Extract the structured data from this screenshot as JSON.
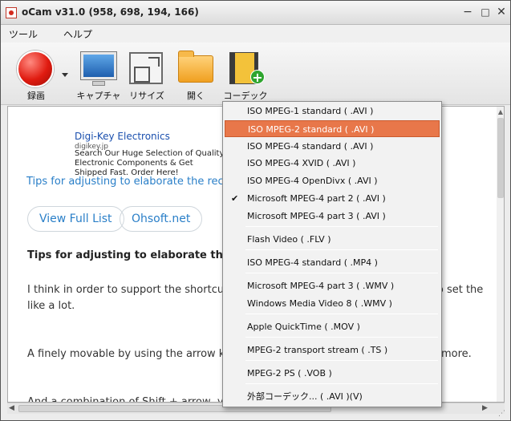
{
  "window": {
    "title": "oCam v31.0 (958, 698, 194, 166)",
    "min_glyph": "−",
    "max_glyph": "□",
    "close_glyph": "✕"
  },
  "menu": {
    "tools": "ツール",
    "help": "ヘルプ"
  },
  "toolbar": {
    "record": "録画",
    "capture": "キャプチャ",
    "resize": "リサイズ",
    "open": "開く",
    "codec": "コーデック"
  },
  "content": {
    "ad_title": "Digi-Key Electronics",
    "ad_url": "digikey.jp",
    "ad_desc": "Search Our Huge Selection of Quality Electronic Components & Get Shipped Fast. Order Here!",
    "article_link": "Tips for adjusting to elaborate the recor",
    "view_full_list": "View Full List",
    "ohsoft": "Ohsoft.net",
    "heading": "Tips for adjusting to elaborate the re",
    "para1": "I think in order to support the shortcut k",
    "para1_right": "w to set the",
    "para1b": "like a lot.",
    "para2": "A finely movable by using the arrow key",
    "para2_right": "more.",
    "para3": "And a combination of Shift + arrow, you"
  },
  "scroll": {
    "up": "▲",
    "left": "◀",
    "right": "▶",
    "grip": "⋰"
  },
  "codec_menu": {
    "check_glyph": "✔",
    "items": [
      "ISO MPEG-1 standard ( .AVI )",
      "ISO MPEG-2 standard ( .AVI )",
      "ISO MPEG-4 standard ( .AVI )",
      "ISO MPEG-4 XVID ( .AVI )",
      "ISO MPEG-4 OpenDivx ( .AVI )",
      "Microsoft MPEG-4 part 2 ( .AVI )",
      "Microsoft MPEG-4 part 3 ( .AVI )",
      "Flash Video ( .FLV )",
      "ISO MPEG-4 standard ( .MP4 )",
      "Microsoft MPEG-4 part 3 ( .WMV )",
      "Windows Media Video 8 ( .WMV )",
      "Apple QuickTime ( .MOV )",
      "MPEG-2 transport stream ( .TS )",
      "MPEG-2 PS ( .VOB )",
      "外部コーデック... ( .AVI )(V)"
    ],
    "selected_index": 1,
    "checked_index": 5
  }
}
